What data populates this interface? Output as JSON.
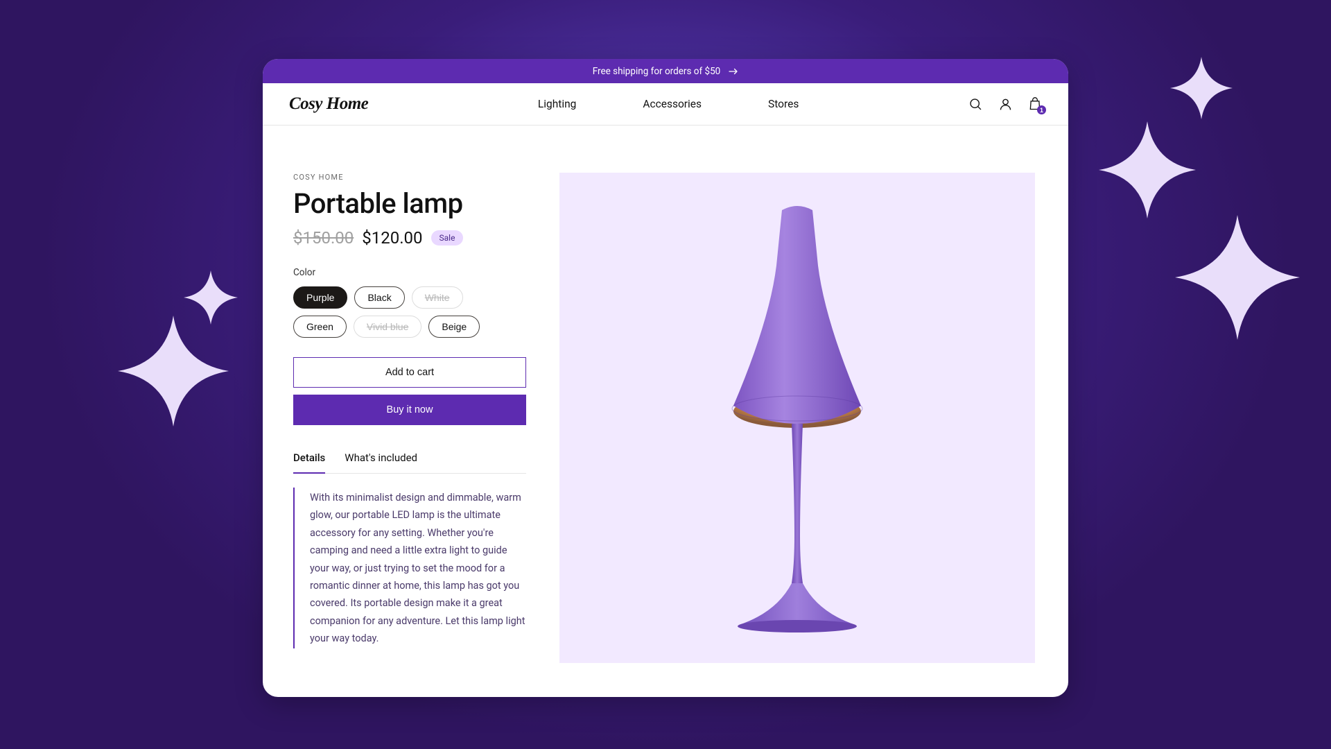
{
  "banner": {
    "text": "Free shipping for orders of $50"
  },
  "brand": "Cosy Home",
  "nav": {
    "items": [
      "Lighting",
      "Accessories",
      "Stores"
    ]
  },
  "cart": {
    "count": "1"
  },
  "product": {
    "vendor": "COSY HOME",
    "title": "Portable lamp",
    "price_old": "$150.00",
    "price_new": "$120.00",
    "sale_label": "Sale",
    "option_label": "Color",
    "colors": [
      {
        "label": "Purple",
        "state": "selected"
      },
      {
        "label": "Black",
        "state": "available"
      },
      {
        "label": "White",
        "state": "disabled"
      },
      {
        "label": "Green",
        "state": "available"
      },
      {
        "label": "Vivid blue",
        "state": "disabled"
      },
      {
        "label": "Beige",
        "state": "available"
      }
    ],
    "add_to_cart": "Add to cart",
    "buy_now": "Buy it now",
    "tabs": [
      {
        "label": "Details",
        "active": true
      },
      {
        "label": "What's included",
        "active": false
      }
    ],
    "description": "With its minimalist design and dimmable, warm glow, our portable LED lamp is the ultimate accessory for any setting. Whether you're camping and need a little extra light to guide your way, or just trying to set the mood for a romantic dinner at home, this lamp has got you covered. Its portable design make it a great companion for any adventure. Let this lamp light your way today."
  },
  "colors": {
    "accent": "#5d2bb0",
    "lamp_body": "#8f68cf",
    "lamp_light": "#f0b574",
    "image_bg": "#f2e9ff"
  }
}
